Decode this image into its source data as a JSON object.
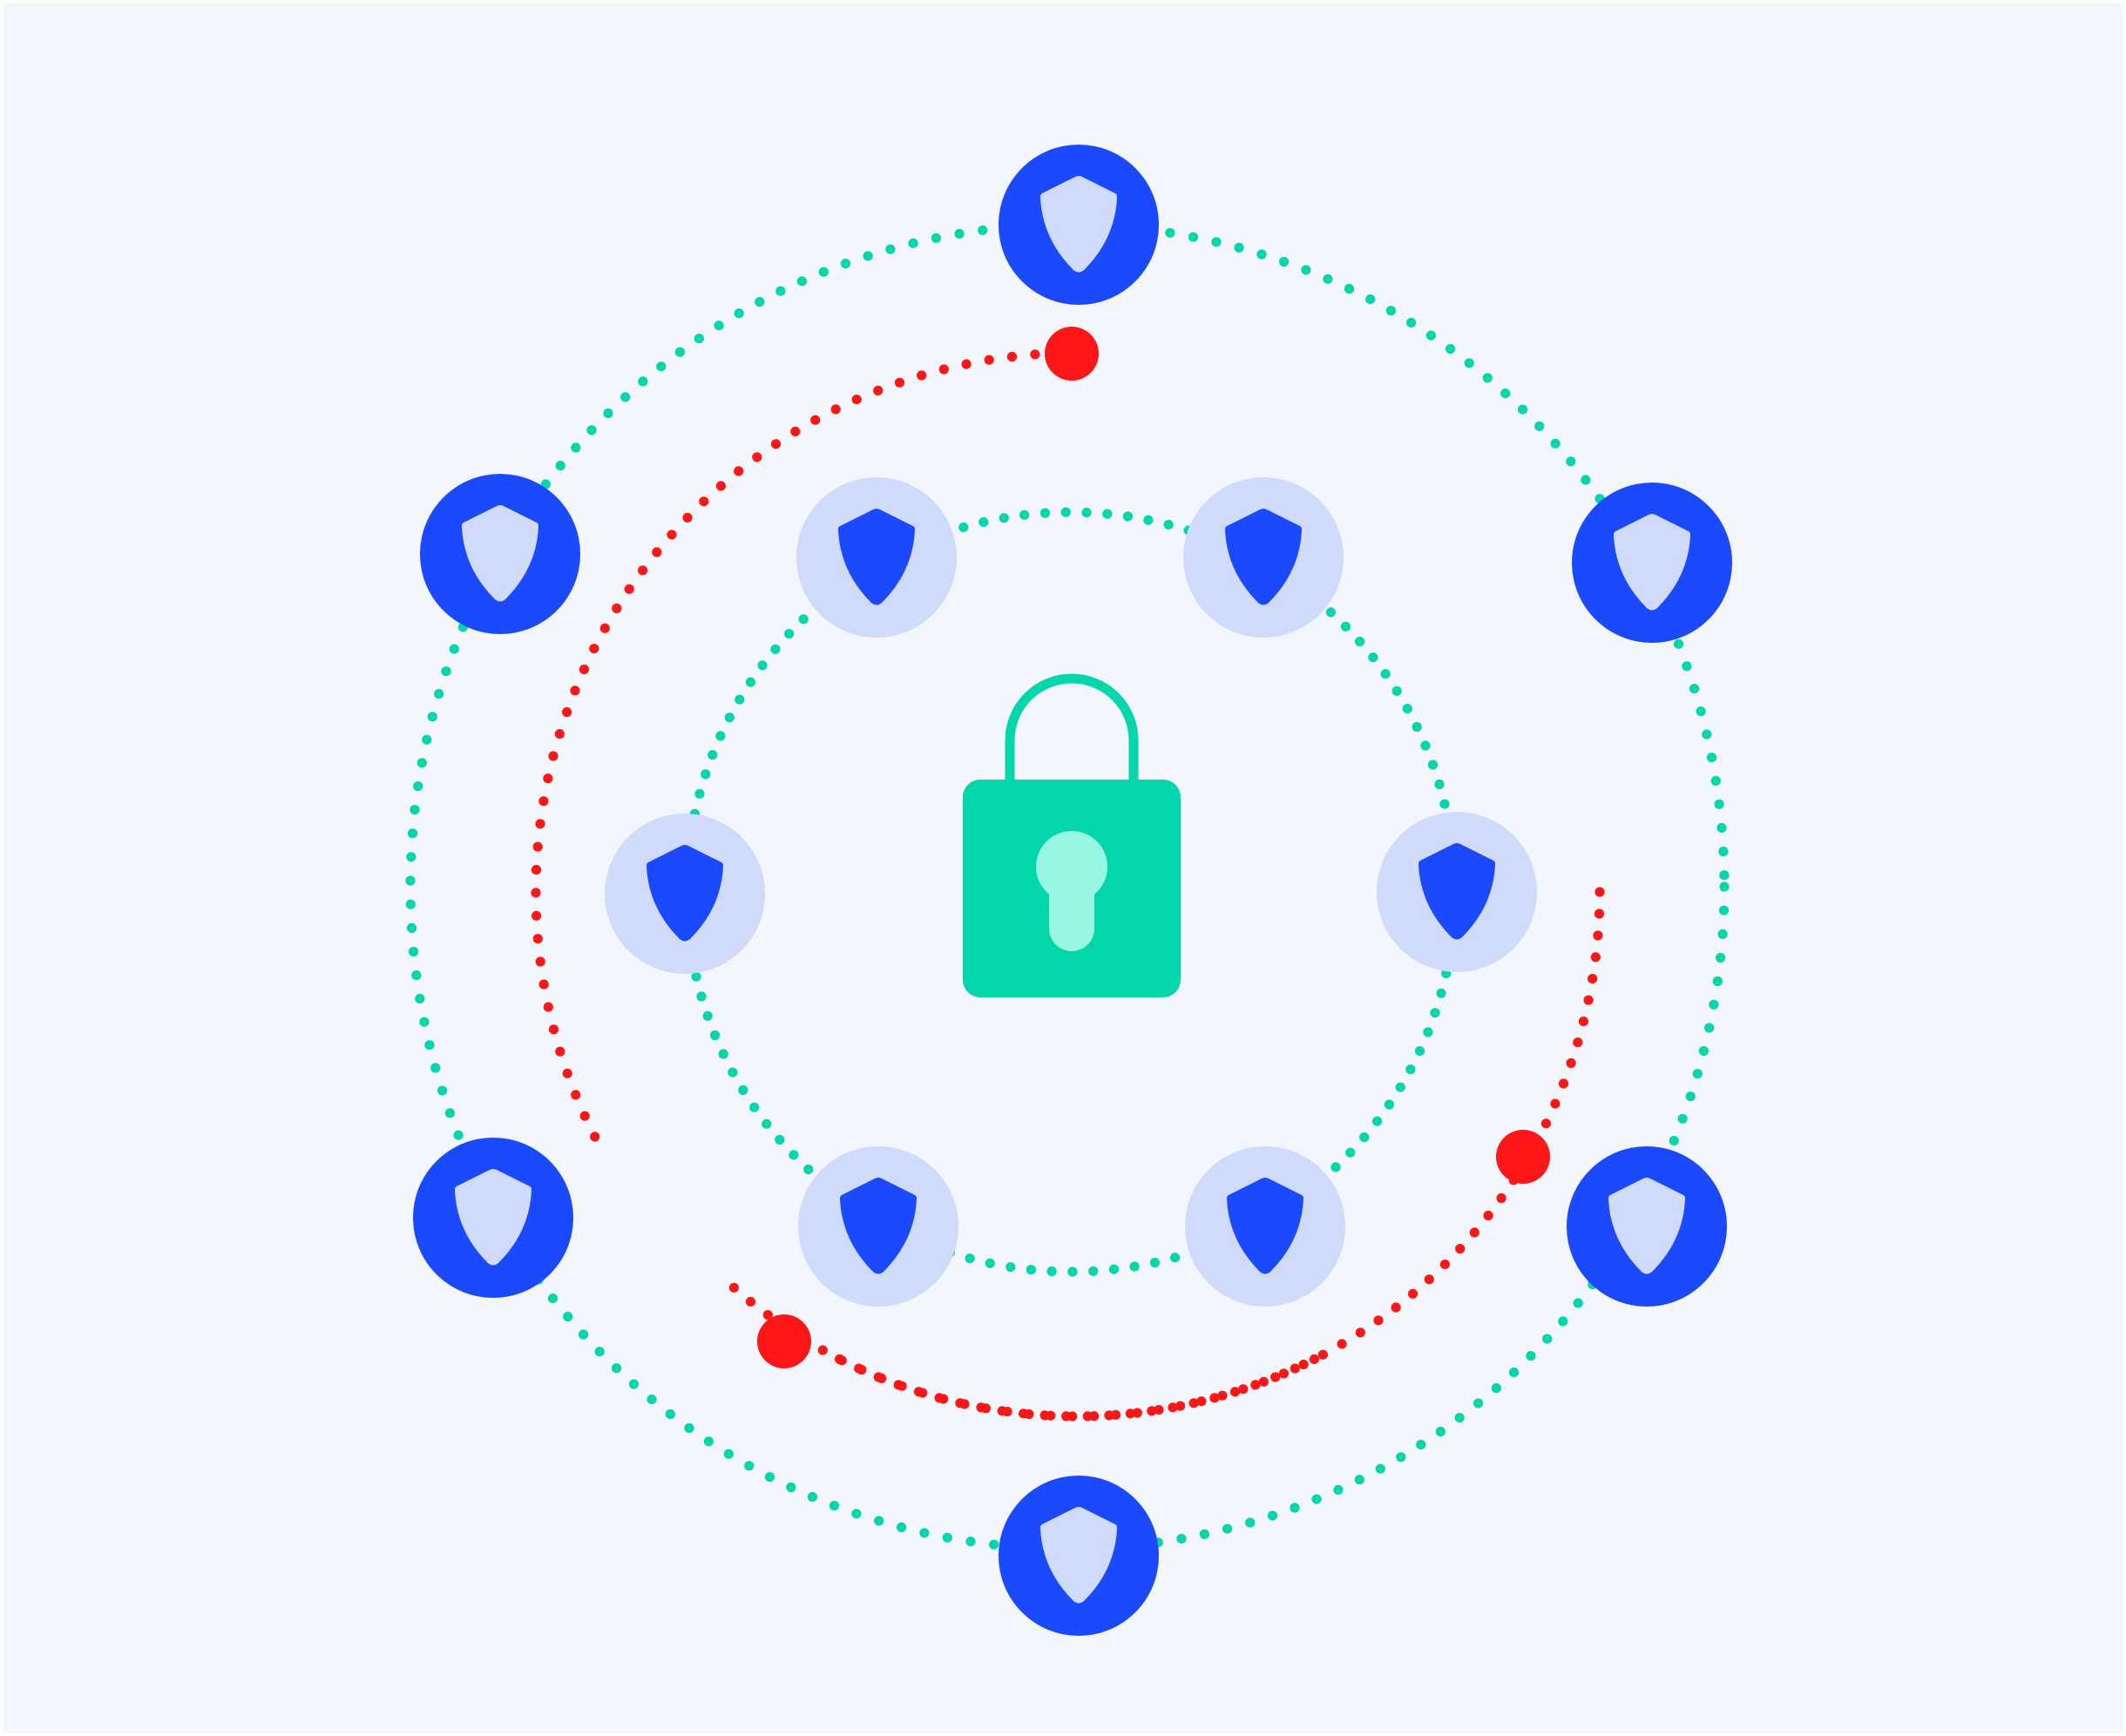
{
  "colors": {
    "background": "#F3F7FD",
    "teal_dots": "#04D6AC",
    "red_threat": "#FF1717",
    "outer_node_fill": "#1B4AFE",
    "outer_shield_fill": "#D0DAFB",
    "inner_node_fill": "#D0DAFB",
    "inner_shield_fill": "#1B4AFE",
    "lock_body": "#04D6AC",
    "lock_shackle": "#04D6AC",
    "keyhole": "#97F7E3"
  },
  "center": {
    "icon": "padlock-icon"
  },
  "outer_ring": {
    "node_icon": "shield-icon",
    "node_count": 6
  },
  "inner_ring": {
    "node_icon": "shield-icon",
    "node_count": 6
  },
  "threats": {
    "icon": "threat-dot",
    "count": 3
  }
}
